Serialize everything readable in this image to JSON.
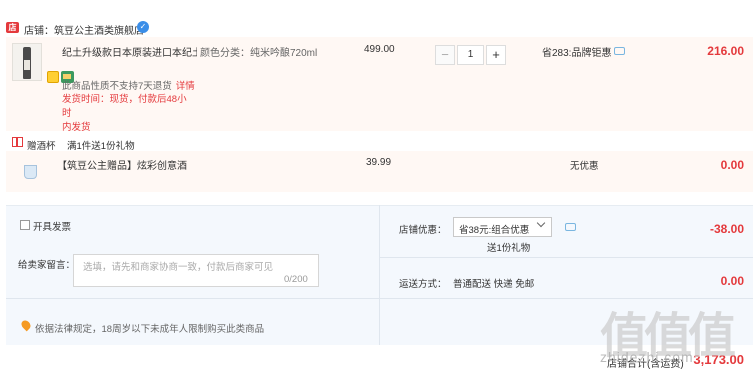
{
  "shop": {
    "badge": "店",
    "label": "店铺：",
    "name": "筑豆公主酒类旗舰店",
    "verified_icon": "verified-icon"
  },
  "item1": {
    "title": "纪土升级款日本原装进口本纪土...",
    "spec": "颜色分类：纯米吟酿720ml",
    "price": "499.00",
    "quantity": "1",
    "minus": "−",
    "plus": "+",
    "promo": "省283:品牌钜惠",
    "total": "216.00",
    "note": "此商品性质不支持7天退货",
    "note_link": "详情",
    "ship_line1": "发货时间：现货，付款后48小时",
    "ship_line2": "内发货"
  },
  "gift": {
    "label": "赠酒杯",
    "desc": "满1件送1份礼物"
  },
  "item2": {
    "title": "【筑豆公主赠品】炫彩创意酒杯...",
    "price": "39.99",
    "no_promo": "无优惠",
    "total": "0.00"
  },
  "order": {
    "invoice_label": "开具发票",
    "message_label": "给卖家留言：",
    "message_placeholder": "选填，请先和商家协商一致，付款后商家可见",
    "message_count": "0/200",
    "law_notice": "依据法律规定，18周岁以下未成年人限制购买此类商品",
    "shop_discount_label": "店铺优惠：",
    "shop_discount_value": "省38元:组合优惠",
    "shop_discount_gift": "送1份礼物",
    "shop_discount_amount": "-38.00",
    "shipping_label": "运送方式：",
    "shipping_method": "普通配送 快递 免邮",
    "shipping_amount": "0.00",
    "shop_total_label": "店铺合计(含运费)",
    "shop_total_amount": "3,173.00"
  },
  "watermark": {
    "main": "值值值",
    "sub": "zhidezhi.com"
  },
  "colors": {
    "accent_red": "#e4393c",
    "panel_blue": "#f4f8fd",
    "item_bg": "#fff8f4"
  }
}
